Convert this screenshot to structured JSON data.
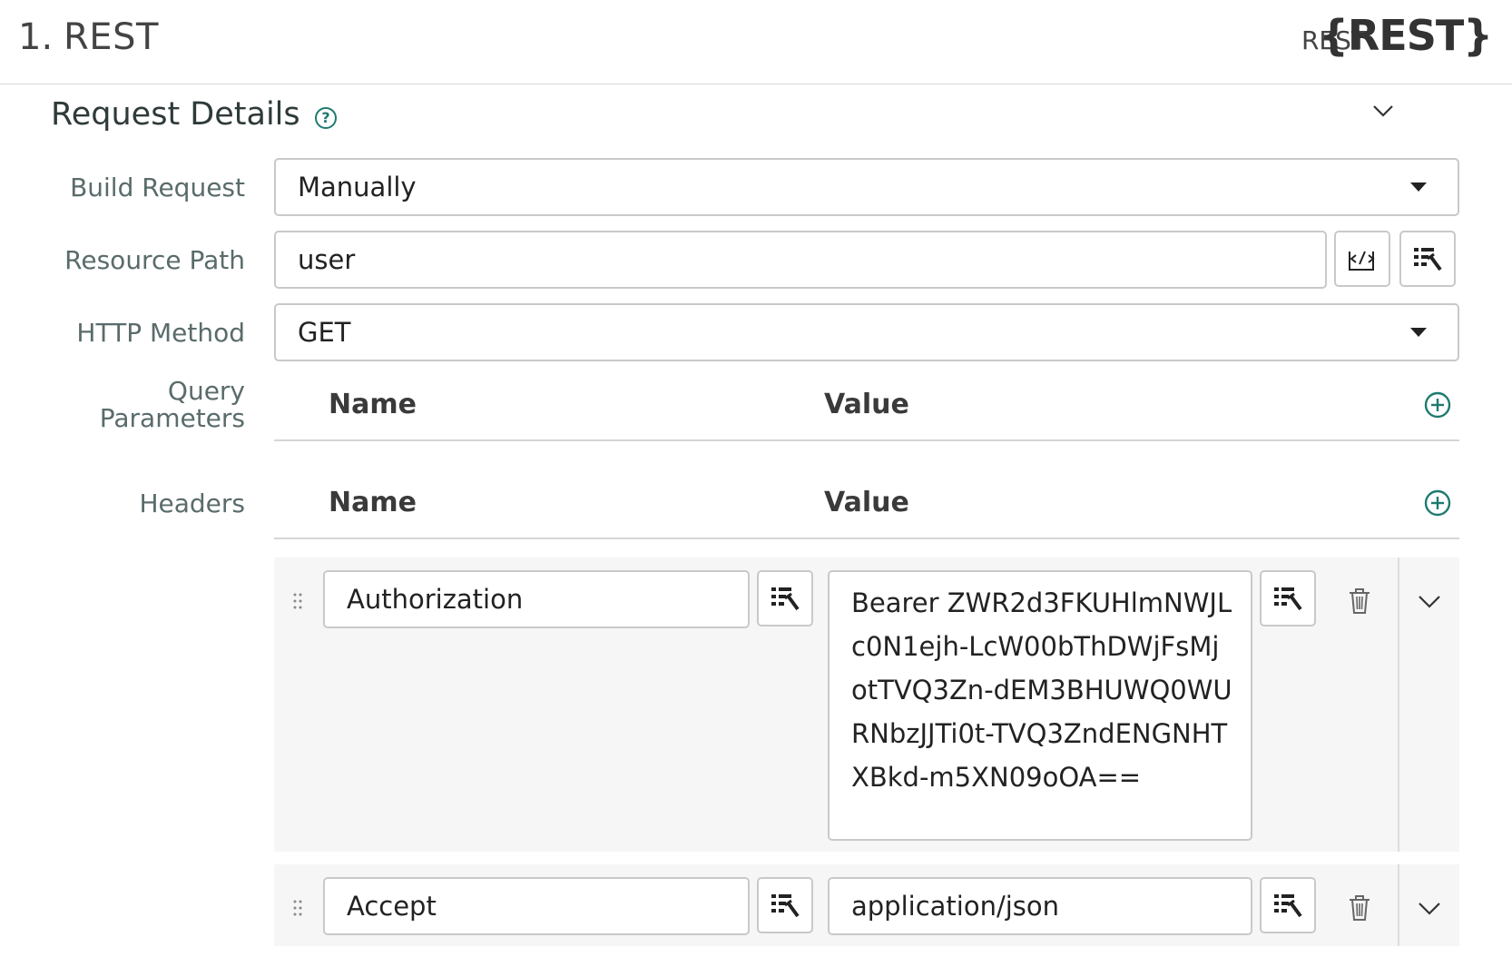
{
  "header": {
    "step_number": "1.",
    "step_title": "REST",
    "connector_type": "REST",
    "connector_logo": "{REST}"
  },
  "section": {
    "title": "Request Details",
    "help_icon": "question-circle-icon",
    "collapse_icon": "chevron-down-icon"
  },
  "form": {
    "build_request": {
      "label": "Build Request",
      "value": "Manually"
    },
    "resource_path": {
      "label": "Resource Path",
      "value": "user"
    },
    "http_method": {
      "label": "HTTP Method",
      "value": "GET"
    },
    "query_parameters": {
      "label_line1": "Query",
      "label_line2": "Parameters",
      "col_name": "Name",
      "col_value": "Value"
    },
    "headers": {
      "label": "Headers",
      "col_name": "Name",
      "col_value": "Value",
      "rows": [
        {
          "name": "Authorization",
          "value": "Bearer ZWR2d3FKUHlmNWJLc0N1ejh-LcW00bThDWjFsMjotTVQ3Zn-dEM3BHUWQ0WURNbzJJTi0t-TVQ3ZndENGNHTXBkd-m5XN09oOA=="
        },
        {
          "name": "Accept",
          "value": "application/json"
        }
      ]
    }
  },
  "colors": {
    "accent": "#1e7a6f",
    "border": "#c9c9c9",
    "label": "#5a6b6b"
  }
}
